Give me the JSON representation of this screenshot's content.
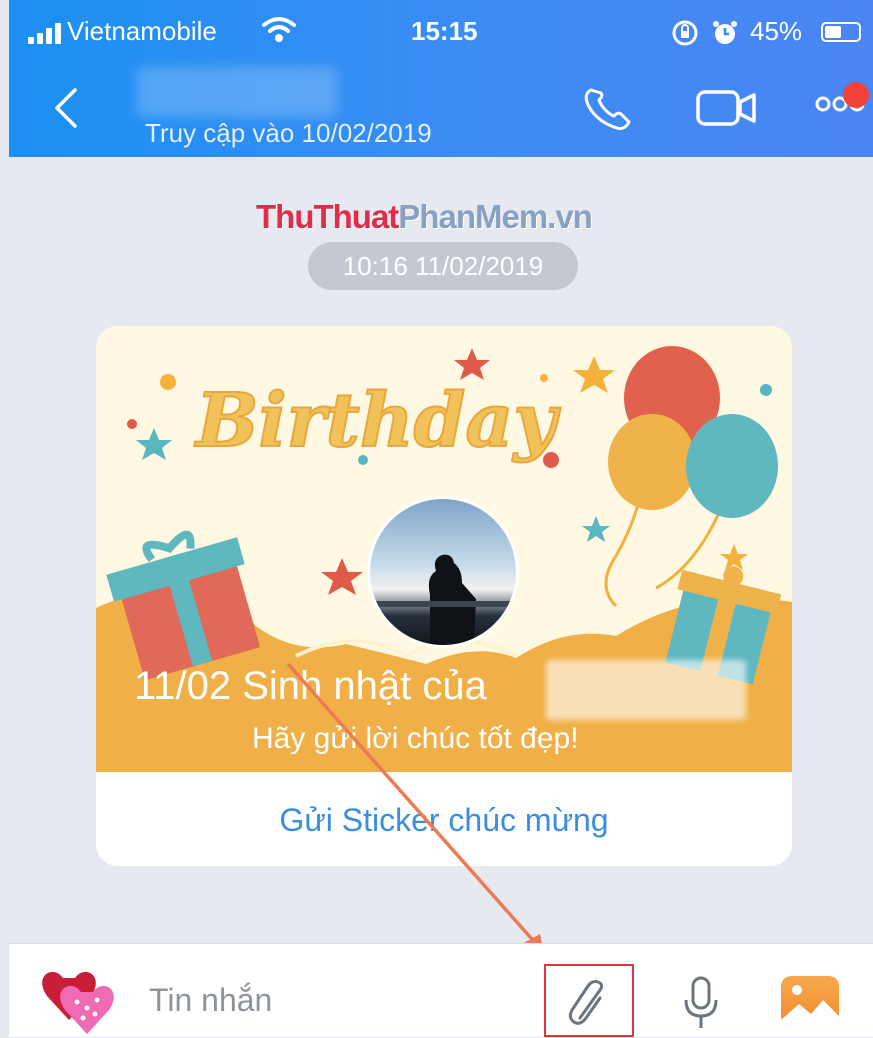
{
  "status_bar": {
    "carrier": "Vietnamobile",
    "time": "15:15",
    "battery_percent": "45%",
    "battery_level": 0.45,
    "icons": [
      "signal-icon",
      "wifi-icon",
      "rotation-lock-icon",
      "alarm-icon",
      "battery-icon"
    ]
  },
  "header": {
    "last_seen": "Truy cập vào 10/02/2019",
    "icons": [
      "back-icon",
      "phone-icon",
      "video-call-icon",
      "more-icon"
    ],
    "accent_color": "#2a8ef5",
    "notification_dot_color": "#f0443a"
  },
  "chat": {
    "watermark_part1": "ThuThuat",
    "watermark_part2": "PhanMem.vn",
    "timestamp": "10:16 11/02/2019",
    "birthday_card": {
      "banner_word": "Birthday",
      "title": "11/02 Sinh nhật của",
      "subtitle": "Hãy gửi lời chúc tốt đẹp!",
      "action": "Gửi Sticker chúc mừng",
      "action_color": "#3a8de0"
    }
  },
  "input_bar": {
    "placeholder": "Tin nhắn",
    "icons": [
      "sticker-icon",
      "attachment-icon",
      "microphone-icon",
      "gallery-icon"
    ],
    "highlight_color": "#e6333b"
  }
}
